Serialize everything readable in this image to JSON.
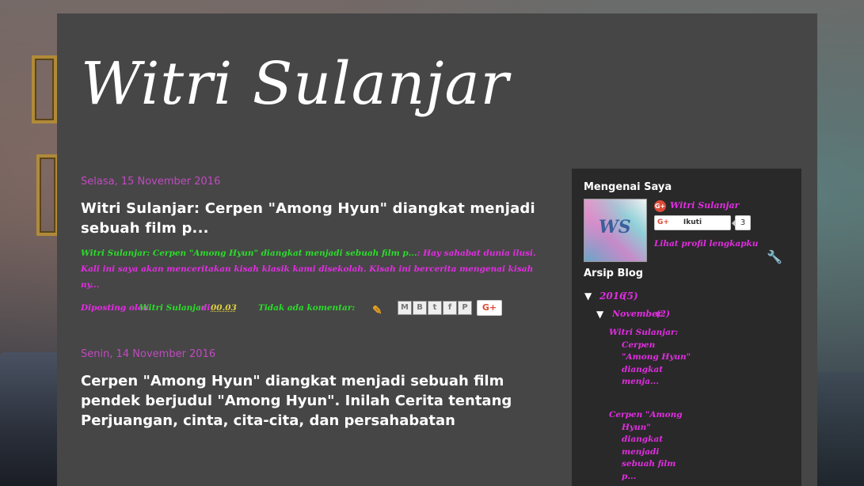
{
  "blog": {
    "title": "Witri Sulanjar"
  },
  "posts": [
    {
      "date": "Selasa, 15 November 2016",
      "title": "Witri Sulanjar: Cerpen \"Among Hyun\" diangkat menjadi sebuah film p...",
      "snippet_link": "Witri Sulanjar: Cerpen \"Among Hyun\" diangkat menjadi sebuah film p...",
      "snippet_text": ": Hay sahabat dunia ilusi. Kali ini saya akan menceritakan kisah klasik kami disekolah. Kisah ini bercerita mengenai kisah ny...",
      "posted_by_label": "Diposting oleh",
      "author": "Witri Sulanjar",
      "at_label": "di",
      "time": "00.03",
      "comments": "Tidak ada komentar:",
      "share_buttons": [
        "M",
        "B",
        "t",
        "f",
        "P"
      ],
      "gplus_label": "G+"
    },
    {
      "date": "Senin, 14 November 2016",
      "title": "Cerpen \"Among Hyun\" diangkat menjadi sebuah film pendek berjudul \"Among Hyun\". Inilah Cerita tentang Perjuangan, cinta, cita-cita, dan persahabatan"
    }
  ],
  "sidebar": {
    "about": {
      "heading": "Mengenai Saya",
      "avatar_text": "WS",
      "gplus_icon": "G+",
      "name": "Witri Sulanjar",
      "follow_icon": "G+",
      "follow_label": "Ikuti",
      "follow_count": "3",
      "profile_link": "Lihat profil lengkapku",
      "tools_icon": "🔧"
    },
    "archive": {
      "heading": "Arsip Blog",
      "toggle": "▼",
      "year": "2016",
      "year_count": "(5)",
      "month": "November",
      "month_count": "(2)",
      "posts": [
        "Witri Sulanjar: Cerpen \"Among Hyun\" diangkat menja...",
        "Cerpen \"Among Hyun\" diangkat menjadi sebuah film p..."
      ]
    }
  }
}
